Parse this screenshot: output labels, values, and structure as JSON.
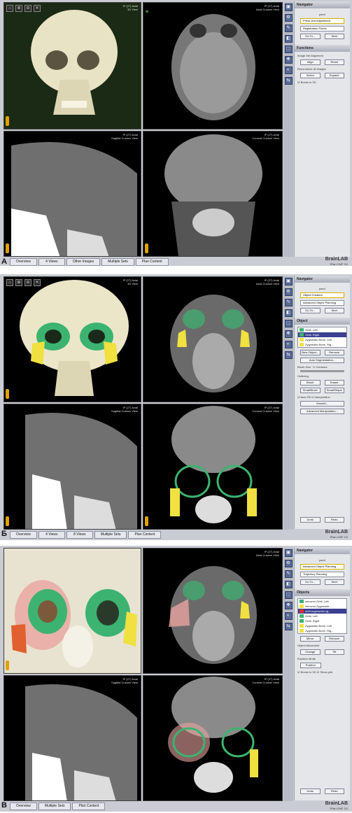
{
  "panels": [
    {
      "letter": "А",
      "views": {
        "v1": {
          "line1": "IP (27) Axial",
          "line2": "3D View"
        },
        "v2": {
          "line1": "IP (27) Axial",
          "line2": "Axial Custom View"
        },
        "v3": {
          "line1": "IP (27) Axial",
          "line2": "Sagittal Custom View"
        },
        "v4": {
          "line1": "IP (27) Axial",
          "line2": "Coronal Custom View"
        }
      },
      "tabs": [
        "Overview",
        "4 Views",
        "Other Images",
        "Multiple Sets",
        "Plan Content"
      ],
      "nav": {
        "title": "Navigator",
        "patient": "pan4",
        "step1": "Press and Adjustment",
        "step2": "Registration Points",
        "go": "Go To...",
        "next": "Next",
        "functions": "Functions",
        "image": "Image Set Alignment",
        "align": "Align",
        "reset": "Reset",
        "recon": "Reconstruct all Images",
        "select": "Select",
        "expand": "Expand",
        "bones": "Bones in 3D"
      },
      "logo": "BrainLAB",
      "sub": "iPlan CMF 3.0"
    },
    {
      "letter": "Б",
      "views": {
        "v1": {
          "line1": "IP (27) Axial",
          "line2": "3D View"
        },
        "v2": {
          "line1": "IP (27) Axial",
          "line2": "Axial Custom View"
        },
        "v3": {
          "line1": "IP (27) Axial",
          "line2": "Sagittal Custom View"
        },
        "v4": {
          "line1": "IP (27) Axial",
          "line2": "Coronal Custom View"
        }
      },
      "tabs": [
        "Overview",
        "4 Views",
        "8 Views",
        "Multiple Sets",
        "Plan Content"
      ],
      "nav": {
        "title": "Navigator",
        "patient": "pan4",
        "step1": "Object Creation",
        "step2": "Advanced Object Planning",
        "go": "Go To...",
        "next": "Next",
        "object": "Object",
        "items": [
          "Orbit, Left",
          "Orbit, Right",
          "Zygomatic Bone, Left",
          "Zygomatic Bone, Rig..."
        ],
        "newobj": "New Object...",
        "remove": "Remove",
        "auto": "Auto Segmentation...",
        "brush": "Brush Size",
        "contours": "Contours",
        "outlining": "Outlining",
        "brush_b": "Brush",
        "eraser": "Eraser",
        "smart": "SmartBrush",
        "smarte": "SmartShape",
        "autofill": "Auto Fill",
        "interp": "Interpolation",
        "smooth": "Smooth...",
        "adv": "Advanced Manipulation...",
        "undo": "Undo",
        "redo": "Redo"
      },
      "logo": "BrainLAB",
      "sub": "iPlan CMF 3.0"
    },
    {
      "letter": "В",
      "views": {
        "v1": {
          "line1": "mirror Axial",
          "line2": "3D View"
        },
        "v2": {
          "line1": "IP (27) Axial",
          "line2": "Axial Custom View"
        },
        "v3": {
          "line1": "IP (27) Axial",
          "line2": "Sagittal Custom View"
        },
        "v4": {
          "line1": "IP (27) Axial",
          "line2": "Coronal Custom View"
        }
      },
      "tabs": [
        "Overview",
        "Multiple Sets",
        "Plan Content"
      ],
      "nav": {
        "title": "Navigator",
        "patient": "pan4",
        "step1": "Advanced Object Planning",
        "step2": "Trajectory Planning",
        "go": "Go To...",
        "next": "Next",
        "objects": "Objects",
        "items": [
          "mirrored Orbit, Left",
          "mirrored Zygomatic...",
          "orbit ergonomic ng...",
          "Orbit, Left",
          "Orbit, Right",
          "Zygomatic Bone, Left",
          "Zygomatic Bone, Rig..."
        ],
        "mirror": "Mirror",
        "remove": "Remove",
        "movement": "Object Movement",
        "change": "Change",
        "tilt": "Tilt",
        "rotate": "Rotation Mode",
        "position": "Position",
        "bones": "Bones in 3D",
        "grid": "Show grid",
        "undo": "Undo",
        "redo": "Redo"
      },
      "logo": "BrainLAB",
      "sub": "iPlan CMF 3.0"
    }
  ],
  "colors": {
    "green": "#3cb371",
    "yellow": "#f0e040",
    "pink": "#e8a4a0",
    "navy": "#3a3f8f"
  }
}
